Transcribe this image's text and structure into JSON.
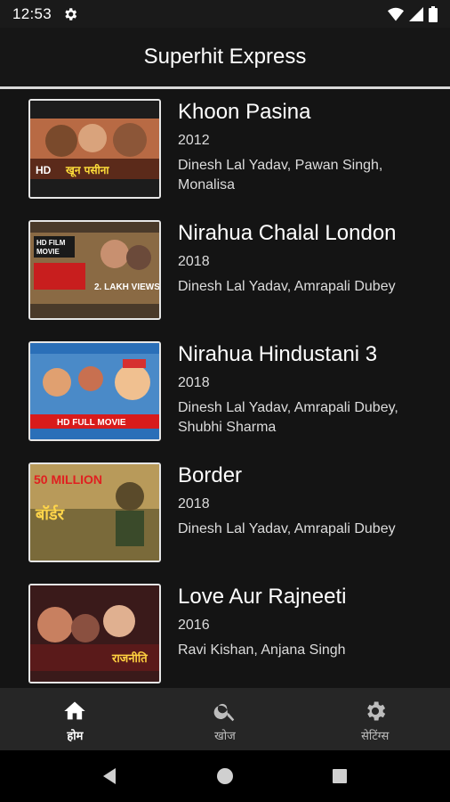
{
  "status": {
    "time": "12:53"
  },
  "app": {
    "title": "Superhit Express"
  },
  "movies": [
    {
      "title": "Khoon Pasina",
      "year": "2012",
      "cast": "Dinesh Lal Yadav, Pawan Singh, Monalisa"
    },
    {
      "title": "Nirahua Chalal London",
      "year": "2018",
      "cast": "Dinesh Lal Yadav, Amrapali Dubey"
    },
    {
      "title": "Nirahua Hindustani 3",
      "year": "2018",
      "cast": "Dinesh Lal Yadav, Amrapali Dubey, Shubhi Sharma"
    },
    {
      "title": "Border",
      "year": "2018",
      "cast": "Dinesh Lal Yadav, Amrapali Dubey"
    },
    {
      "title": "Love Aur Rajneeti",
      "year": "2016",
      "cast": "Ravi Kishan, Anjana Singh"
    }
  ],
  "thumbs": [
    {
      "caption": "HD",
      "caption2": "खून पसीना"
    },
    {
      "caption": "HD FILM MOVIE",
      "caption2": "2. LAKH VIEWS"
    },
    {
      "caption": "HD FULL MOVIE",
      "caption2": ""
    },
    {
      "caption": "50 MILLION",
      "caption2": "बॉर्डर"
    },
    {
      "caption": "राजनीति",
      "caption2": ""
    }
  ],
  "nav": {
    "home": "होम",
    "search": "खोज",
    "settings": "सेटिंग्स"
  },
  "colors": {
    "background": "#141414",
    "appbar": "#161616",
    "bottom_nav": "#262626"
  }
}
